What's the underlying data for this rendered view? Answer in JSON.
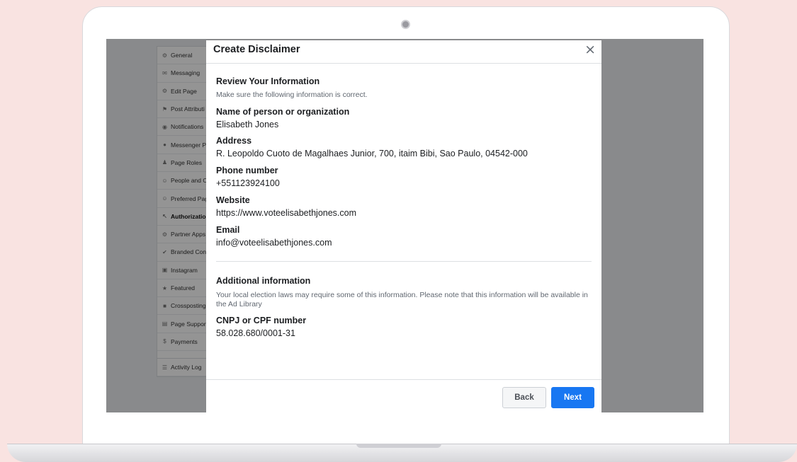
{
  "sidebar": {
    "items": [
      {
        "icon": "⚙",
        "label": "General"
      },
      {
        "icon": "✉",
        "label": "Messaging"
      },
      {
        "icon": "⚙",
        "label": "Edit Page"
      },
      {
        "icon": "⚑",
        "label": "Post Attributi"
      },
      {
        "icon": "◉",
        "label": "Notifications"
      },
      {
        "icon": "●",
        "label": "Messenger P"
      },
      {
        "icon": "♟",
        "label": "Page Roles"
      },
      {
        "icon": "☺",
        "label": "People and O"
      },
      {
        "icon": "☺",
        "label": "Preferred Pag"
      },
      {
        "icon": "↖",
        "label": "Authorization",
        "bold": true
      },
      {
        "icon": "⚙",
        "label": "Partner Apps"
      },
      {
        "icon": "✔",
        "label": "Branded Con"
      },
      {
        "icon": "▣",
        "label": "Instagram"
      },
      {
        "icon": "★",
        "label": "Featured"
      },
      {
        "icon": "■",
        "label": "Crossposting"
      },
      {
        "icon": "▤",
        "label": "Page Support"
      },
      {
        "icon": "$",
        "label": "Payments"
      }
    ],
    "activity": {
      "icon": "☰",
      "label": "Activity Log"
    }
  },
  "modal": {
    "title": "Create Disclaimer",
    "close_glyph": "×",
    "review_heading": "Review Your Information",
    "review_subtitle": "Make sure the following information is correct.",
    "fields": [
      {
        "label": "Name of person or organization",
        "value": "Elisabeth Jones"
      },
      {
        "label": "Address",
        "value": "R. Leopoldo Cuoto de Magalhaes Junior, 700, itaim Bibi, Sao Paulo, 04542-000"
      },
      {
        "label": "Phone number",
        "value": "+551123924100"
      },
      {
        "label": "Website",
        "value": "https://www.voteelisabethjones.com"
      },
      {
        "label": "Email",
        "value": "info@voteelisabethjones.com"
      }
    ],
    "additional_heading": "Additional information",
    "additional_note": "Your local election laws may require some of this information. Please note that this information will be available in the Ad Library",
    "cnpj": {
      "label": "CNPJ or CPF number",
      "value": "58.028.680/0001-31"
    },
    "back_label": "Back",
    "next_label": "Next"
  }
}
